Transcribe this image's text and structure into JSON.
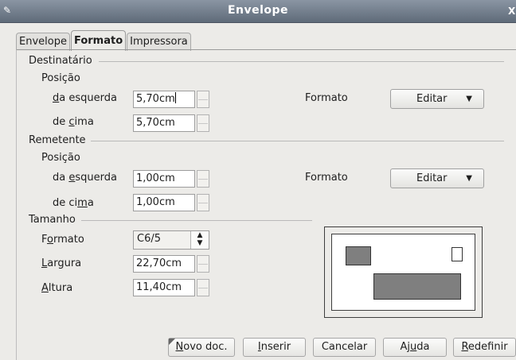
{
  "window": {
    "title": "Envelope"
  },
  "tabs": [
    "Envelope",
    "Formato",
    "Impressora"
  ],
  "addressee": {
    "section": "Destinatário",
    "position": "Posição",
    "left_label": "da esquerda",
    "top_label": "de cima",
    "left_value": "5,70cm",
    "top_value": "5,70cm",
    "format_label": "Formato",
    "edit_label": "Editar"
  },
  "sender": {
    "section": "Remetente",
    "position": "Posição",
    "left_label": "da esquerda",
    "top_label": "de cima",
    "left_value": "1,00cm",
    "top_value": "1,00cm",
    "format_label": "Formato",
    "edit_label": "Editar"
  },
  "size": {
    "section": "Tamanho",
    "format_label": "Formato",
    "format_value": "C6/5",
    "width_label": "Largura",
    "width_value": "22,70cm",
    "height_label": "Altura",
    "height_value": "11,40cm"
  },
  "buttons": {
    "new_doc": "Novo doc.",
    "insert": "Inserir",
    "cancel": "Cancelar",
    "help": "Ajuda",
    "reset": "Redefinir"
  },
  "colors": {
    "titlebar": "#6f7a88",
    "preview_fill": "#7f7f7f"
  }
}
